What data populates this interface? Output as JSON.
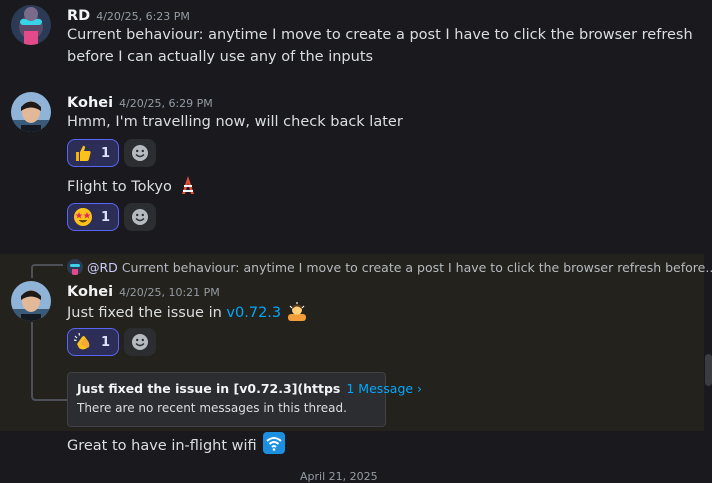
{
  "messages": [
    {
      "author": "RD",
      "timestamp": "4/20/25, 6:23 PM",
      "lines": [
        "Current behaviour: anytime I move to create a post I have to click the browser refresh",
        "before I can actually use any of the inputs"
      ]
    },
    {
      "author": "Kohei",
      "timestamp": "4/20/25, 6:29 PM",
      "text": "Hmm, I'm travelling now, will check back later",
      "reaction": {
        "emoji": "thumbs-up",
        "count": "1"
      },
      "followup": "Flight to Tokyo",
      "followup_emoji": "tokyo-tower",
      "followup_reaction": {
        "emoji": "star-struck",
        "count": "1"
      }
    },
    {
      "reply": {
        "mention": "@RD",
        "snippet": "Current behaviour: anytime I move to create a post I have to click the browser refresh before..."
      },
      "author": "Kohei",
      "timestamp": "4/20/25, 10:21 PM",
      "text_prefix": "Just fixed the issue in",
      "link_text": "v0.72.3",
      "trailing_emoji": "person-bowing",
      "reaction": {
        "emoji": "clapping-hands",
        "count": "1"
      },
      "thread": {
        "title": "Just fixed the issue in [v0.72.3](https",
        "count_label": "1 Message ›",
        "subtitle": "There are no recent messages in this thread."
      }
    },
    {
      "text": "Great to have in-flight wifi",
      "trailing_emoji": "wifi-icon"
    }
  ],
  "date_divider": "April 21, 2025",
  "colors": {
    "background": "#1a1a1e",
    "highlight": "#24221c",
    "reaction_border": "#5865f2",
    "link": "#00a8fc"
  }
}
